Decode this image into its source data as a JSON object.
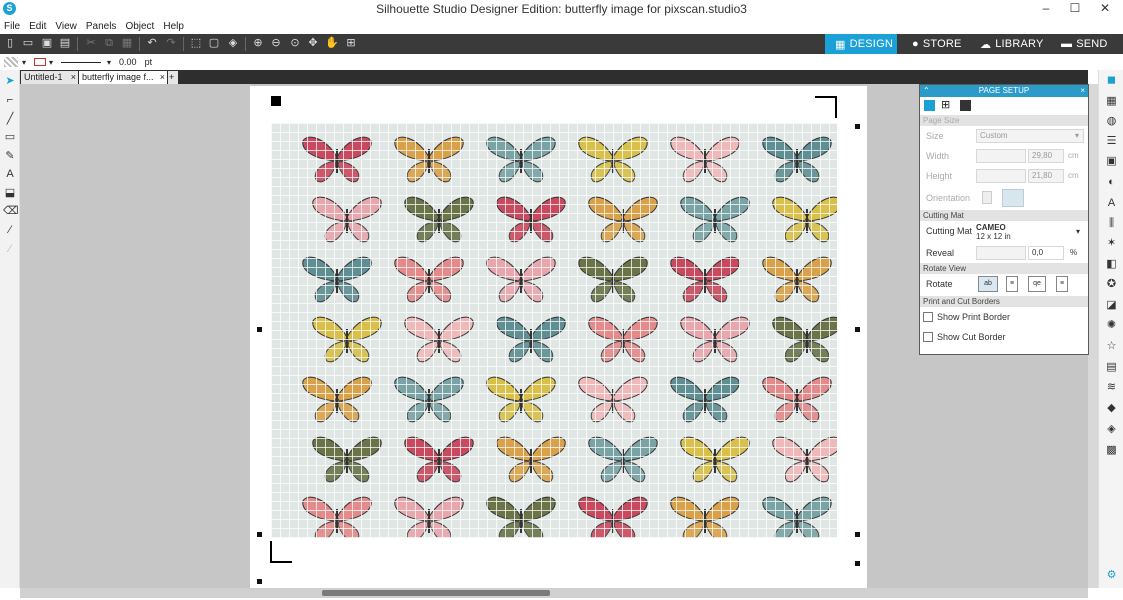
{
  "window": {
    "title": "Silhouette Studio Designer Edition: butterfly image for pixscan.studio3",
    "minimize": "–",
    "maximize": "☐",
    "close": "✕"
  },
  "menu": [
    "File",
    "Edit",
    "View",
    "Panels",
    "Object",
    "Help"
  ],
  "modes": {
    "design": "DESIGN",
    "store": "STORE",
    "library": "LIBRARY",
    "send": "SEND",
    "active": "design",
    "accent": "#1ba1d6"
  },
  "line_settings": {
    "width_value": "0.00",
    "unit": "pt"
  },
  "doc_tabs": [
    {
      "label": "Untitled-1",
      "close": "×"
    },
    {
      "label": "butterfly image f...",
      "close": "×"
    },
    {
      "label": "+"
    }
  ],
  "panel": {
    "title": "PAGE SETUP",
    "close": "×",
    "sections": {
      "page_size": "Page Size",
      "cutting_mat": "Cutting Mat",
      "rotate_view": "Rotate View",
      "borders": "Print and Cut Borders"
    },
    "size_label": "Size",
    "size_value": "Custom",
    "width_label": "Width",
    "width_value": "29,80",
    "width_unit": "cm",
    "height_label": "Height",
    "height_value": "21,80",
    "height_unit": "cm",
    "orientation_label": "Orientation",
    "mat_label": "Cutting Mat",
    "mat_value": "CAMEO",
    "mat_sub": "12 x 12 in",
    "reveal_label": "Reveal",
    "reveal_value": "0,0",
    "reveal_unit": "%",
    "rotate_label": "Rotate",
    "print_border": "Show Print Border",
    "cut_border": "Show Cut Border"
  },
  "colors": {
    "panel_header": "#2b9bc9",
    "toolbar": "#3a3a3a",
    "canvas": "#c6c6c6"
  }
}
